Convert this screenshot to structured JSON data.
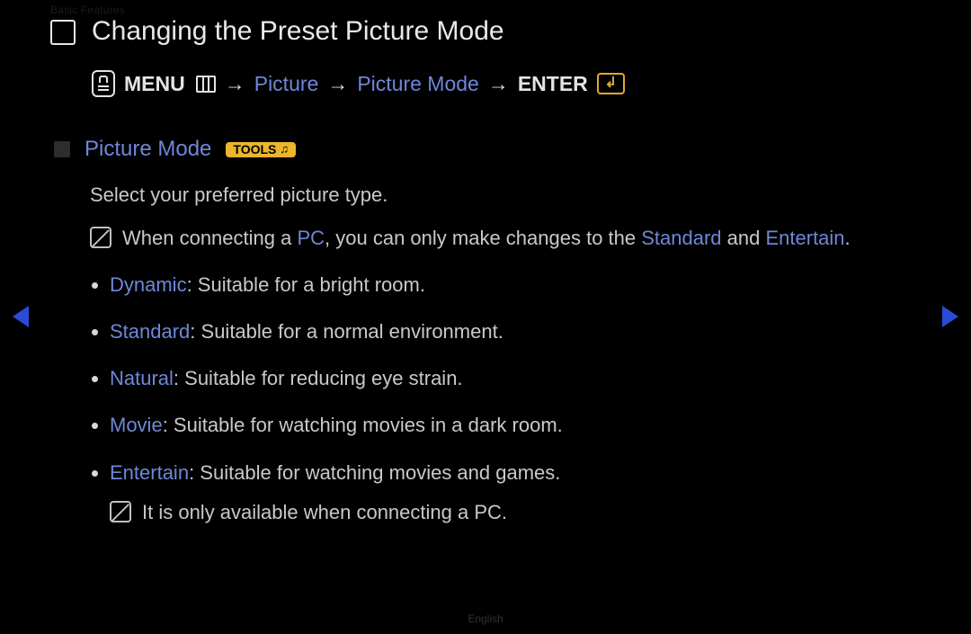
{
  "ghost_header": "Basic Features",
  "title": "Changing the Preset Picture Mode",
  "breadcrumb": {
    "menu_label": "MENU",
    "path1": "Picture",
    "path2": "Picture Mode",
    "enter_label": "ENTER",
    "arrow": "→"
  },
  "section": {
    "heading": "Picture Mode",
    "tools_label": "TOOLS",
    "intro": "Select your preferred picture type.",
    "note": {
      "pre": "When connecting a ",
      "pc": "PC",
      "mid": ", you can only make changes to the ",
      "standard": "Standard",
      "and": " and ",
      "entertain": "Entertain",
      "post": "."
    },
    "modes": [
      {
        "name": "Dynamic",
        "desc": ": Suitable for a bright room."
      },
      {
        "name": "Standard",
        "desc": ": Suitable for a normal environment."
      },
      {
        "name": "Natural",
        "desc": ": Suitable for reducing eye strain."
      },
      {
        "name": "Movie",
        "desc": ": Suitable for watching movies in a dark room."
      },
      {
        "name": "Entertain",
        "desc": ": Suitable for watching movies and games."
      }
    ],
    "sub_note": "It is only available when connecting a PC."
  },
  "footer_language": "English"
}
